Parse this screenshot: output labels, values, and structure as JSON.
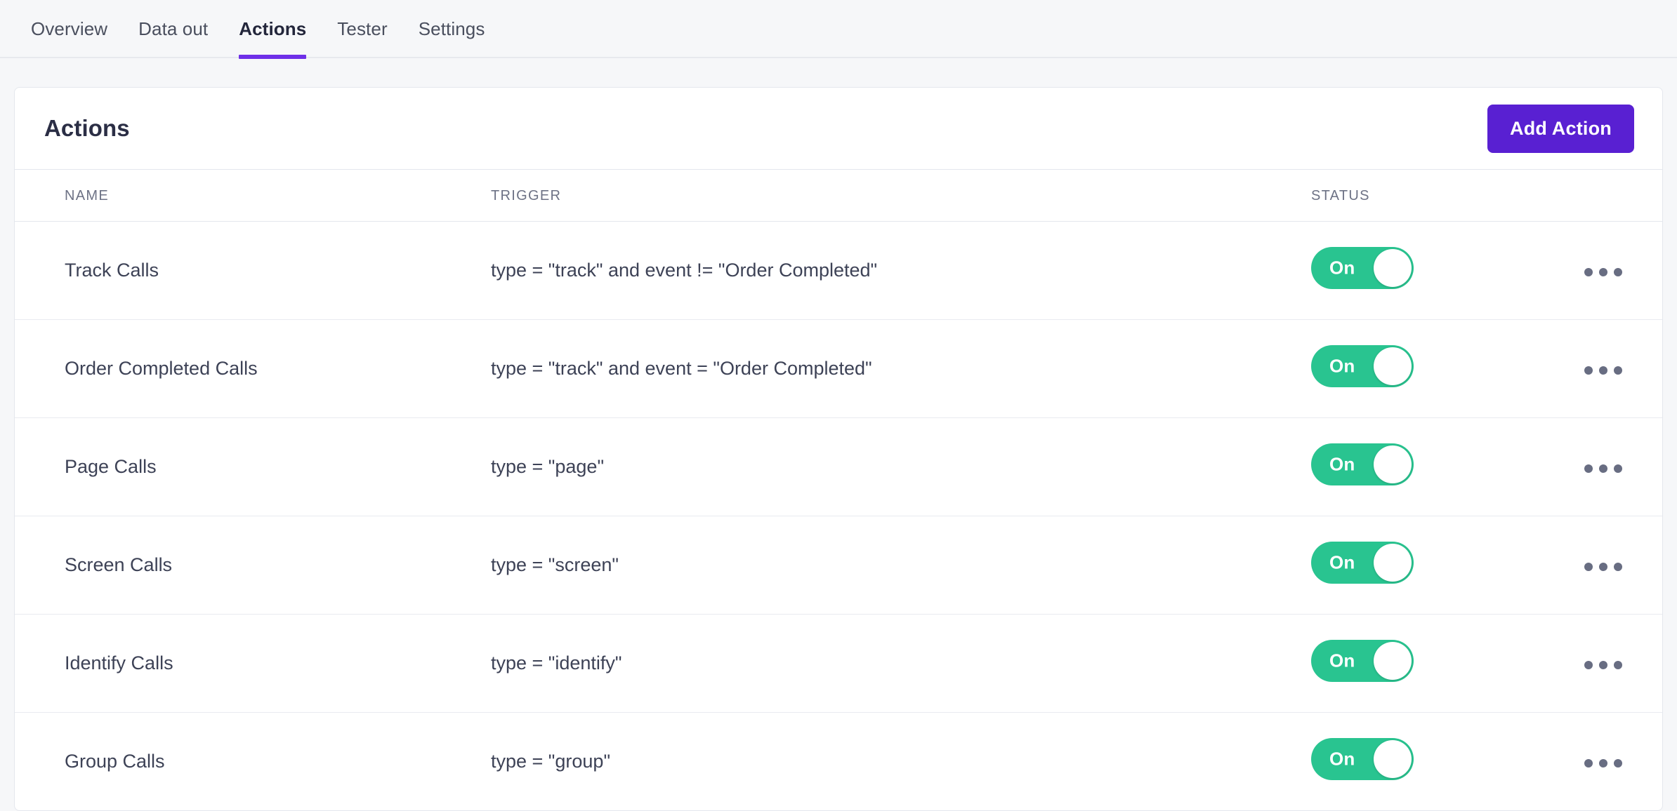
{
  "theme": {
    "accent_purple": "#5920d2",
    "tab_underline": "#6e2fe8",
    "toggle_on_green": "#29c490",
    "page_bg": "#f6f7f9",
    "card_bg": "#ffffff",
    "border": "#e4e7ed",
    "text_primary": "#2b2e45",
    "text_secondary": "#6d7285"
  },
  "tabs": [
    {
      "label": "Overview",
      "active": false
    },
    {
      "label": "Data out",
      "active": false
    },
    {
      "label": "Actions",
      "active": true
    },
    {
      "label": "Tester",
      "active": false
    },
    {
      "label": "Settings",
      "active": false
    }
  ],
  "card": {
    "title": "Actions",
    "add_button_label": "Add Action"
  },
  "table": {
    "columns": [
      "NAME",
      "TRIGGER",
      "STATUS",
      ""
    ],
    "rows": [
      {
        "name": "Track Calls",
        "trigger": "type = \"track\" and event != \"Order Completed\"",
        "status_label": "On",
        "status_on": true,
        "menu_icon": "ellipsis-icon"
      },
      {
        "name": "Order Completed Calls",
        "trigger": "type = \"track\" and event = \"Order Completed\"",
        "status_label": "On",
        "status_on": true,
        "menu_icon": "ellipsis-icon"
      },
      {
        "name": "Page Calls",
        "trigger": "type = \"page\"",
        "status_label": "On",
        "status_on": true,
        "menu_icon": "ellipsis-icon"
      },
      {
        "name": "Screen Calls",
        "trigger": "type = \"screen\"",
        "status_label": "On",
        "status_on": true,
        "menu_icon": "ellipsis-icon"
      },
      {
        "name": "Identify Calls",
        "trigger": "type = \"identify\"",
        "status_label": "On",
        "status_on": true,
        "menu_icon": "ellipsis-icon"
      },
      {
        "name": "Group Calls",
        "trigger": "type = \"group\"",
        "status_label": "On",
        "status_on": true,
        "menu_icon": "ellipsis-icon"
      }
    ]
  }
}
